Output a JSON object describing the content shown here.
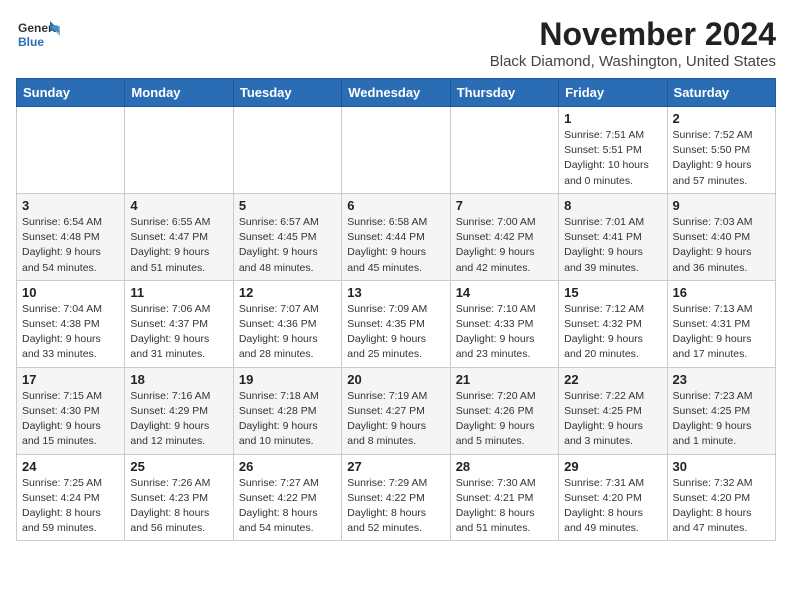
{
  "header": {
    "logo_general": "General",
    "logo_blue": "Blue",
    "month": "November 2024",
    "location": "Black Diamond, Washington, United States"
  },
  "days_of_week": [
    "Sunday",
    "Monday",
    "Tuesday",
    "Wednesday",
    "Thursday",
    "Friday",
    "Saturday"
  ],
  "weeks": [
    [
      {
        "day": "",
        "info": ""
      },
      {
        "day": "",
        "info": ""
      },
      {
        "day": "",
        "info": ""
      },
      {
        "day": "",
        "info": ""
      },
      {
        "day": "",
        "info": ""
      },
      {
        "day": "1",
        "info": "Sunrise: 7:51 AM\nSunset: 5:51 PM\nDaylight: 10 hours\nand 0 minutes."
      },
      {
        "day": "2",
        "info": "Sunrise: 7:52 AM\nSunset: 5:50 PM\nDaylight: 9 hours\nand 57 minutes."
      }
    ],
    [
      {
        "day": "3",
        "info": "Sunrise: 6:54 AM\nSunset: 4:48 PM\nDaylight: 9 hours\nand 54 minutes."
      },
      {
        "day": "4",
        "info": "Sunrise: 6:55 AM\nSunset: 4:47 PM\nDaylight: 9 hours\nand 51 minutes."
      },
      {
        "day": "5",
        "info": "Sunrise: 6:57 AM\nSunset: 4:45 PM\nDaylight: 9 hours\nand 48 minutes."
      },
      {
        "day": "6",
        "info": "Sunrise: 6:58 AM\nSunset: 4:44 PM\nDaylight: 9 hours\nand 45 minutes."
      },
      {
        "day": "7",
        "info": "Sunrise: 7:00 AM\nSunset: 4:42 PM\nDaylight: 9 hours\nand 42 minutes."
      },
      {
        "day": "8",
        "info": "Sunrise: 7:01 AM\nSunset: 4:41 PM\nDaylight: 9 hours\nand 39 minutes."
      },
      {
        "day": "9",
        "info": "Sunrise: 7:03 AM\nSunset: 4:40 PM\nDaylight: 9 hours\nand 36 minutes."
      }
    ],
    [
      {
        "day": "10",
        "info": "Sunrise: 7:04 AM\nSunset: 4:38 PM\nDaylight: 9 hours\nand 33 minutes."
      },
      {
        "day": "11",
        "info": "Sunrise: 7:06 AM\nSunset: 4:37 PM\nDaylight: 9 hours\nand 31 minutes."
      },
      {
        "day": "12",
        "info": "Sunrise: 7:07 AM\nSunset: 4:36 PM\nDaylight: 9 hours\nand 28 minutes."
      },
      {
        "day": "13",
        "info": "Sunrise: 7:09 AM\nSunset: 4:35 PM\nDaylight: 9 hours\nand 25 minutes."
      },
      {
        "day": "14",
        "info": "Sunrise: 7:10 AM\nSunset: 4:33 PM\nDaylight: 9 hours\nand 23 minutes."
      },
      {
        "day": "15",
        "info": "Sunrise: 7:12 AM\nSunset: 4:32 PM\nDaylight: 9 hours\nand 20 minutes."
      },
      {
        "day": "16",
        "info": "Sunrise: 7:13 AM\nSunset: 4:31 PM\nDaylight: 9 hours\nand 17 minutes."
      }
    ],
    [
      {
        "day": "17",
        "info": "Sunrise: 7:15 AM\nSunset: 4:30 PM\nDaylight: 9 hours\nand 15 minutes."
      },
      {
        "day": "18",
        "info": "Sunrise: 7:16 AM\nSunset: 4:29 PM\nDaylight: 9 hours\nand 12 minutes."
      },
      {
        "day": "19",
        "info": "Sunrise: 7:18 AM\nSunset: 4:28 PM\nDaylight: 9 hours\nand 10 minutes."
      },
      {
        "day": "20",
        "info": "Sunrise: 7:19 AM\nSunset: 4:27 PM\nDaylight: 9 hours\nand 8 minutes."
      },
      {
        "day": "21",
        "info": "Sunrise: 7:20 AM\nSunset: 4:26 PM\nDaylight: 9 hours\nand 5 minutes."
      },
      {
        "day": "22",
        "info": "Sunrise: 7:22 AM\nSunset: 4:25 PM\nDaylight: 9 hours\nand 3 minutes."
      },
      {
        "day": "23",
        "info": "Sunrise: 7:23 AM\nSunset: 4:25 PM\nDaylight: 9 hours\nand 1 minute."
      }
    ],
    [
      {
        "day": "24",
        "info": "Sunrise: 7:25 AM\nSunset: 4:24 PM\nDaylight: 8 hours\nand 59 minutes."
      },
      {
        "day": "25",
        "info": "Sunrise: 7:26 AM\nSunset: 4:23 PM\nDaylight: 8 hours\nand 56 minutes."
      },
      {
        "day": "26",
        "info": "Sunrise: 7:27 AM\nSunset: 4:22 PM\nDaylight: 8 hours\nand 54 minutes."
      },
      {
        "day": "27",
        "info": "Sunrise: 7:29 AM\nSunset: 4:22 PM\nDaylight: 8 hours\nand 52 minutes."
      },
      {
        "day": "28",
        "info": "Sunrise: 7:30 AM\nSunset: 4:21 PM\nDaylight: 8 hours\nand 51 minutes."
      },
      {
        "day": "29",
        "info": "Sunrise: 7:31 AM\nSunset: 4:20 PM\nDaylight: 8 hours\nand 49 minutes."
      },
      {
        "day": "30",
        "info": "Sunrise: 7:32 AM\nSunset: 4:20 PM\nDaylight: 8 hours\nand 47 minutes."
      }
    ]
  ]
}
